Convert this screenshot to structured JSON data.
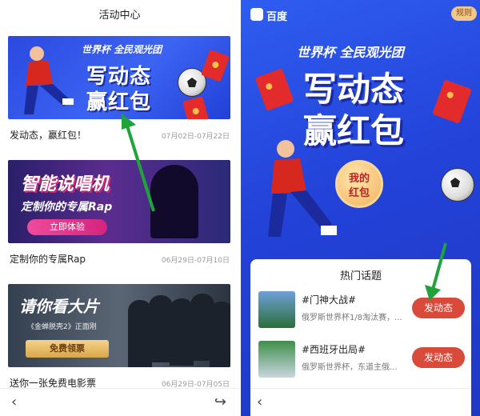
{
  "left": {
    "title": "活动中心",
    "items": [
      {
        "banner_small": "世界杯 全民观光团",
        "banner_big_1": "写动态",
        "banner_big_2": "赢红包",
        "caption": "发动态，赢红包！",
        "date": "07月02日-07月22日"
      },
      {
        "banner_title": "智能说唱机",
        "banner_sub": "定制你的专属Rap",
        "banner_button": "立即体验",
        "caption": "定制你的专属Rap",
        "date": "06月29日-07月10日"
      },
      {
        "banner_title": "请你看大片",
        "banner_sub": "《金蝉脱壳2》正面刚",
        "banner_button": "免费领票",
        "caption": "送你一张免费电影票",
        "date": "06月29日-07月05日"
      }
    ],
    "nav": {
      "back_icon": "‹",
      "share_icon": "↪"
    }
  },
  "right": {
    "logo": "百度",
    "rules_label": "规则",
    "banner_small": "世界杯 全民观光团",
    "banner_big_1": "写动态",
    "banner_big_2": "赢红包",
    "my_red_line1": "我的",
    "my_red_line2": "红包",
    "topics_title": "热门话题",
    "topics": [
      {
        "name": "#门神大战#",
        "desc": "俄罗斯世界杯1/8淘汰赛，...",
        "button": "发动态"
      },
      {
        "name": "#西班牙出局#",
        "desc": "俄罗斯世界杯，东道主俄...",
        "button": "发动态"
      }
    ],
    "nav": {
      "back_icon": "‹"
    }
  },
  "colors": {
    "accent_red": "#d94a3a",
    "banner_blue": "#2545dc",
    "arrow_green": "#1fa33a"
  }
}
